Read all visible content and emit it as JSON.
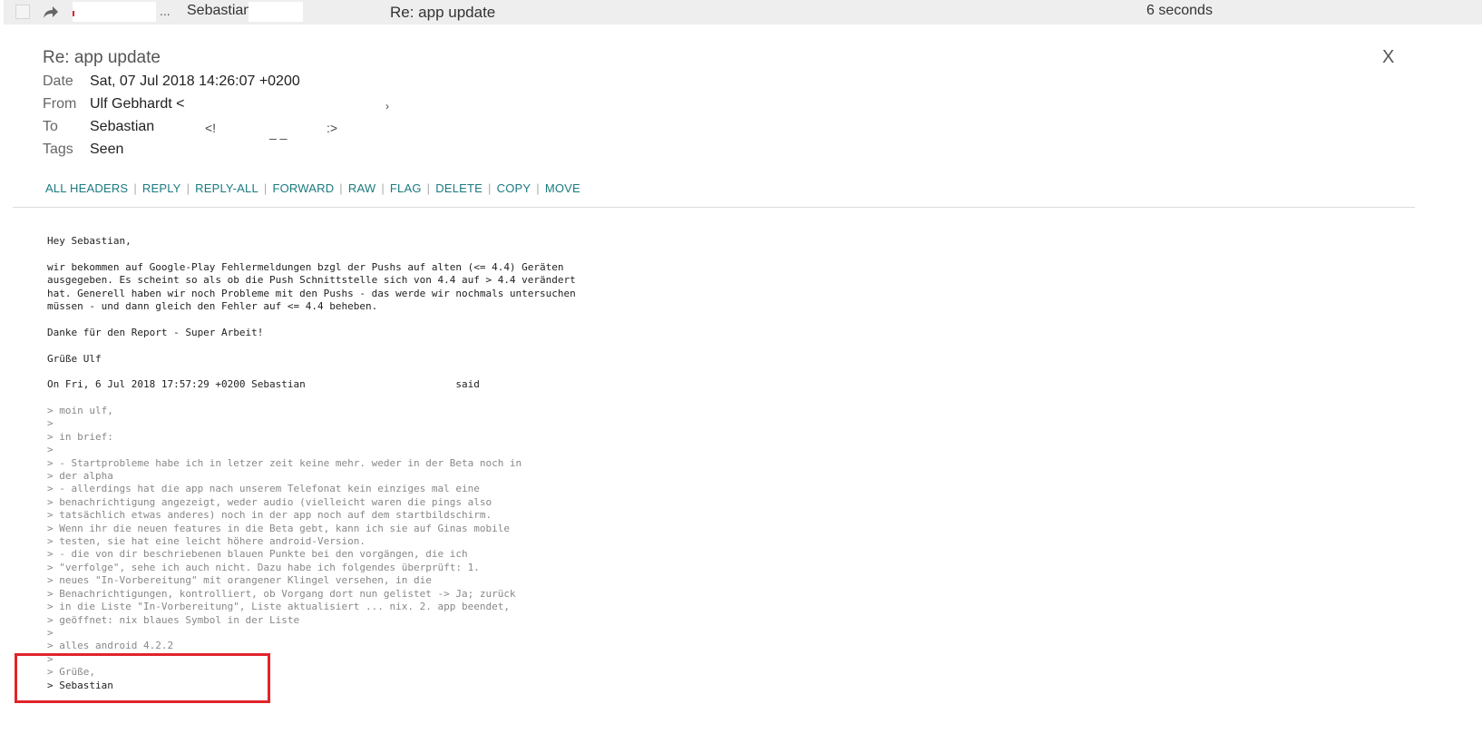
{
  "list_row": {
    "ellipsis": "...",
    "from": "Sebastian",
    "subject": "Re: app update",
    "time": "6 seconds"
  },
  "message": {
    "title": "Re: app update",
    "close_label": "X",
    "headers": {
      "date_label": "Date",
      "date_value": "Sat, 07 Jul 2018 14:26:07 +0200",
      "from_label": "From",
      "from_value": "Ulf Gebhardt <",
      "to_label": "To",
      "to_value": "Sebastian",
      "tags_label": "Tags",
      "tags_value": "Seen"
    },
    "actions": [
      "ALL HEADERS",
      "REPLY",
      "REPLY-ALL",
      "FORWARD",
      "RAW",
      "FLAG",
      "DELETE",
      "COPY",
      "MOVE"
    ],
    "body": "Hey Sebastian,\n\nwir bekommen auf Google-Play Fehlermeldungen bzgl der Pushs auf alten (<= 4.4) Geräten\nausgegeben. Es scheint so als ob die Push Schnittstelle sich von 4.4 auf > 4.4 verändert\nhat. Generell haben wir noch Probleme mit den Pushs - das werde wir nochmals untersuchen\nmüssen - und dann gleich den Fehler auf <= 4.4 beheben.\n\nDanke für den Report - Super Arbeit!\n\nGrüße Ulf\n\nOn Fri, 6 Jul 2018 17:57:29 +0200 Sebastian                         said",
    "quote": "> moin ulf,\n>\n> in brief:\n>\n> - Startprobleme habe ich in letzer zeit keine mehr. weder in der Beta noch in\n> der alpha\n> - allerdings hat die app nach unserem Telefonat kein einziges mal eine\n> benachrichtigung angezeigt, weder audio (vielleicht waren die pings also\n> tatsächlich etwas anderes) noch in der app noch auf dem startbildschirm.\n> Wenn ihr die neuen features in die Beta gebt, kann ich sie auf Ginas mobile\n> testen, sie hat eine leicht höhere android-Version.\n> - die von dir beschriebenen blauen Punkte bei den vorgängen, die ich\n> \"verfolge\", sehe ich auch nicht. Dazu habe ich folgendes überprüft: 1.\n> neues \"In-Vorbereitung\" mit orangener Klingel versehen, in die\n> Benachrichtigungen, kontrolliert, ob Vorgang dort nun gelistet -> Ja; zurück\n> in die Liste \"In-Vorbereitung\", Liste aktualisiert ... nix. 2. app beendet,\n> geöffnet: nix blaues Symbol in der Liste\n>\n> alles android 4.2.2\n>\n> Grüße,",
    "quote_last": "> Sebastian"
  }
}
